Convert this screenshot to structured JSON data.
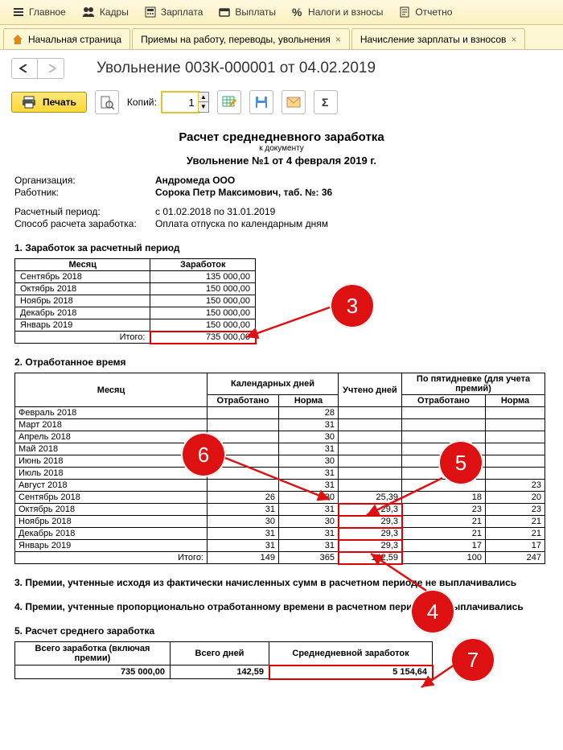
{
  "menu": {
    "main": "Главное",
    "hr": "Кадры",
    "salary": "Зарплата",
    "payments": "Выплаты",
    "taxes": "Налоги и взносы",
    "reports": "Отчетно"
  },
  "tabs": {
    "home": "Начальная страница",
    "t1": "Приемы на работу, переводы, увольнения",
    "t2": "Начисление зарплаты и взносов"
  },
  "nav": {
    "title": "Увольнение 003К-000001 от 04.02.2019"
  },
  "toolbar": {
    "print": "Печать",
    "copies_label": "Копий:",
    "copies_value": "1"
  },
  "report": {
    "title": "Расчет среднедневного заработка",
    "subtitle": "к документу",
    "doc": "Увольнение №1 от 4 февраля 2019 г.",
    "org_label": "Организация:",
    "org": "Андромеда ООО",
    "emp_label": "Работник:",
    "emp": "Сорока Петр Максимович, таб. №: 36",
    "period_label": "Расчетный период:",
    "period": "с 01.02.2018 по 31.01.2019",
    "method_label": "Способ расчета заработка:",
    "method": "Оплата отпуска по календарным дням",
    "s1": "1. Заработок за расчетный период",
    "t1": {
      "h1": "Месяц",
      "h2": "Заработок",
      "rows": [
        [
          "Сентябрь 2018",
          "135 000,00"
        ],
        [
          "Октябрь 2018",
          "150 000,00"
        ],
        [
          "Ноябрь 2018",
          "150 000,00"
        ],
        [
          "Декабрь 2018",
          "150 000,00"
        ],
        [
          "Январь 2019",
          "150 000,00"
        ]
      ],
      "total_label": "Итого:",
      "total": "735 000,00"
    },
    "s2": "2. Отработанное время",
    "t2": {
      "h_month": "Месяц",
      "h_cal": "Календарных дней",
      "h_acc": "Учтено дней",
      "h_five": "По пятидневке (для учета премий)",
      "h_worked": "Отработано",
      "h_norm": "Норма",
      "rows": [
        {
          "m": "Февраль 2018",
          "cw": "",
          "cn": "28",
          "acc": "",
          "fw": "",
          "fn": ""
        },
        {
          "m": "Март 2018",
          "cw": "",
          "cn": "31",
          "acc": "",
          "fw": "",
          "fn": ""
        },
        {
          "m": "Апрель 2018",
          "cw": "",
          "cn": "30",
          "acc": "",
          "fw": "",
          "fn": ""
        },
        {
          "m": "Май 2018",
          "cw": "",
          "cn": "31",
          "acc": "",
          "fw": "",
          "fn": ""
        },
        {
          "m": "Июнь 2018",
          "cw": "",
          "cn": "30",
          "acc": "",
          "fw": "",
          "fn": ""
        },
        {
          "m": "Июль 2018",
          "cw": "",
          "cn": "31",
          "acc": "",
          "fw": "",
          "fn": ""
        },
        {
          "m": "Август 2018",
          "cw": "",
          "cn": "31",
          "acc": "",
          "fw": "",
          "fn": "23"
        },
        {
          "m": "Сентябрь 2018",
          "cw": "26",
          "cn": "30",
          "acc": "25,39",
          "fw": "18",
          "fn": "20"
        },
        {
          "m": "Октябрь 2018",
          "cw": "31",
          "cn": "31",
          "acc": "29,3",
          "fw": "23",
          "fn": "23"
        },
        {
          "m": "Ноябрь 2018",
          "cw": "30",
          "cn": "30",
          "acc": "29,3",
          "fw": "21",
          "fn": "21"
        },
        {
          "m": "Декабрь 2018",
          "cw": "31",
          "cn": "31",
          "acc": "29,3",
          "fw": "21",
          "fn": "21"
        },
        {
          "m": "Январь 2019",
          "cw": "31",
          "cn": "31",
          "acc": "29,3",
          "fw": "17",
          "fn": "17"
        }
      ],
      "total_label": "Итого:",
      "tcw": "149",
      "tcn": "365",
      "tacc": "142,59",
      "tfw": "100",
      "tfn": "247"
    },
    "s3": "3. Премии, учтенные исходя из фактически начисленных сумм в расчетном периоде не выплачивались",
    "s4": "4. Премии, учтенные пропорционально отработанному времени в расчетном периоде не выплачивались",
    "s5": "5. Расчет среднего  заработка",
    "t3": {
      "h1": "Всего заработка (включая премии)",
      "h2": "Всего дней",
      "h3": "Среднедневной заработок",
      "v1": "735 000,00",
      "v2": "142,59",
      "v3": "5 154,64"
    },
    "ann": {
      "a3": "3",
      "a4": "4",
      "a5": "5",
      "a6": "6",
      "a7": "7"
    }
  }
}
